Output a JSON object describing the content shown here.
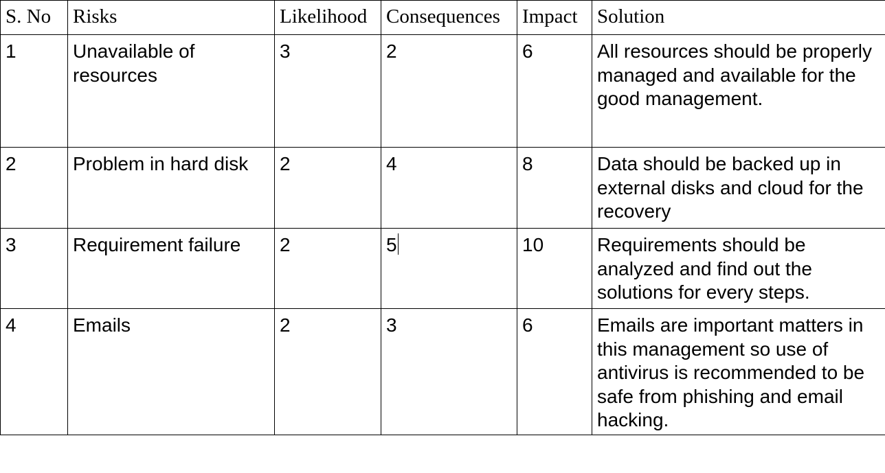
{
  "table": {
    "headers": [
      "S. No",
      "Risks",
      "Likelihood",
      "Consequences",
      "Impact",
      "Solution"
    ],
    "rows": [
      {
        "sno": "1",
        "risk": "Unavailable of resources",
        "likelihood": "3",
        "consequences": "2",
        "impact": "6",
        "solution": "All resources should be properly managed and available for the good management."
      },
      {
        "sno": "2",
        "risk": "Problem in hard disk",
        "likelihood": "2",
        "consequences": "4",
        "impact": "8",
        "solution": "Data should be backed up in external disks and cloud for the recovery"
      },
      {
        "sno": "3",
        "risk": "Requirement failure",
        "likelihood": "2",
        "consequences": "5",
        "impact": "10",
        "solution": "Requirements should be analyzed and find out the solutions for every steps."
      },
      {
        "sno": "4",
        "risk": "Emails",
        "likelihood": "2",
        "consequences": "3",
        "impact": "6",
        "solution": "Emails are important matters in this management so use of antivirus is recommended to be safe from phishing and email hacking."
      }
    ]
  }
}
